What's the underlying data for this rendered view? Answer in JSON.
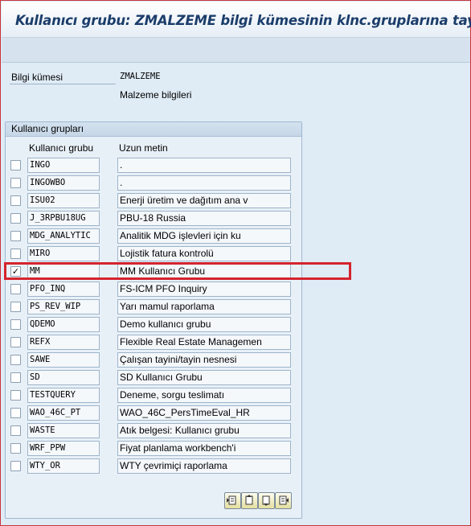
{
  "window": {
    "title": "Kullanıcı grubu: ZMALZEME bilgi kümesinin klnc.gruplarına tayini"
  },
  "infoset": {
    "label": "Bilgi kümesi",
    "value": "ZMALZEME",
    "description": "Malzeme bilgileri"
  },
  "groupbox": {
    "title": "Kullanıcı grupları",
    "col_group": "Kullanıcı grubu",
    "col_text": "Uzun metin"
  },
  "rows": [
    {
      "group": "INGO",
      "text": ".",
      "checked": false
    },
    {
      "group": "INGOWBO",
      "text": ".",
      "checked": false
    },
    {
      "group": "ISU02",
      "text": "Enerji üretim ve dağıtım ana v",
      "checked": false
    },
    {
      "group": "J_3RPBU18UG",
      "text": "PBU-18 Russia",
      "checked": false
    },
    {
      "group": "MDG_ANALYTIC",
      "text": "Analitik MDG işlevleri için ku",
      "checked": false
    },
    {
      "group": "MIRO",
      "text": "Lojistik fatura kontrolü",
      "checked": false
    },
    {
      "group": "MM",
      "text": "MM Kullanıcı Grubu",
      "checked": true
    },
    {
      "group": "PFO_INQ",
      "text": "FS-ICM PFO Inquiry",
      "checked": false
    },
    {
      "group": "PS_REV_WIP",
      "text": "Yarı mamul raporlama",
      "checked": false
    },
    {
      "group": "QDEMO",
      "text": "Demo kullanıcı grubu",
      "checked": false
    },
    {
      "group": "REFX",
      "text": "Flexible Real Estate Managemen",
      "checked": false
    },
    {
      "group": "SAWE",
      "text": "Çalışan tayini/tayin nesnesi",
      "checked": false
    },
    {
      "group": "SD",
      "text": "SD Kullanıcı Grubu",
      "checked": false
    },
    {
      "group": "TESTQUERY",
      "text": "Deneme, sorgu teslimatı",
      "checked": false
    },
    {
      "group": "WAO_46C_PT",
      "text": "WAO_46C_PersTimeEval_HR",
      "checked": false
    },
    {
      "group": "WASTE",
      "text": "Atık belgesi: Kullanıcı grubu",
      "checked": false
    },
    {
      "group": "WRF_PPW",
      "text": "Fiyat planlama workbench'i",
      "checked": false
    },
    {
      "group": "WTY_OR",
      "text": "WTY çevrimiçi raporlama",
      "checked": false
    }
  ],
  "checkmark": "✓",
  "table_buttons": [
    {
      "icon": "scroll-first-page-icon"
    },
    {
      "icon": "scroll-previous-page-icon"
    },
    {
      "icon": "scroll-next-page-icon"
    },
    {
      "icon": "scroll-last-page-icon"
    }
  ],
  "colors": {
    "title_text": "#1b3d6b",
    "highlight_border": "#d4242e",
    "background": "#dfebf5"
  }
}
